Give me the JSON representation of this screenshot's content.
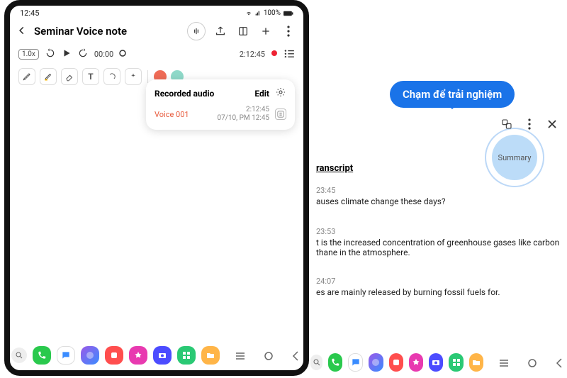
{
  "statusBar": {
    "time": "12:45",
    "network": "100%"
  },
  "header": {
    "title": "Seminar Voice note"
  },
  "audio": {
    "speed": "1.0x",
    "elapsed": "00:00",
    "total": "2:12:45"
  },
  "recorded": {
    "heading": "Recorded audio",
    "edit": "Edit",
    "item": {
      "name": "Voice 001",
      "duration": "2:12:45",
      "datetime": "07/10, PM 12:45"
    }
  },
  "tooltip": "Chạm để trải nghiệm",
  "right": {
    "tab": "ranscript",
    "summary": "Summary",
    "messages": [
      {
        "ts": "23:45",
        "text": "auses climate change these days?"
      },
      {
        "ts": "23:53",
        "text": "t is the increased concentration of greenhouse gases like carbon thane in the atmosphere."
      },
      {
        "ts": "24:07",
        "text": "es are mainly released by burning fossil fuels for."
      }
    ]
  },
  "dock": {
    "colors": [
      "#eee",
      "#2ac94d",
      "#3a8cff",
      "#9b59e8",
      "#ff4e4e",
      "#e83ab0",
      "#4c4cff",
      "#2ac974",
      "#ffb548"
    ],
    "colors2": [
      "#eee",
      "#2ac94d",
      "#3a8cff",
      "#9b59e8",
      "#ff4e4e",
      "#e83ab0",
      "#4c4cff",
      "#2ac974",
      "#ffb548"
    ]
  }
}
